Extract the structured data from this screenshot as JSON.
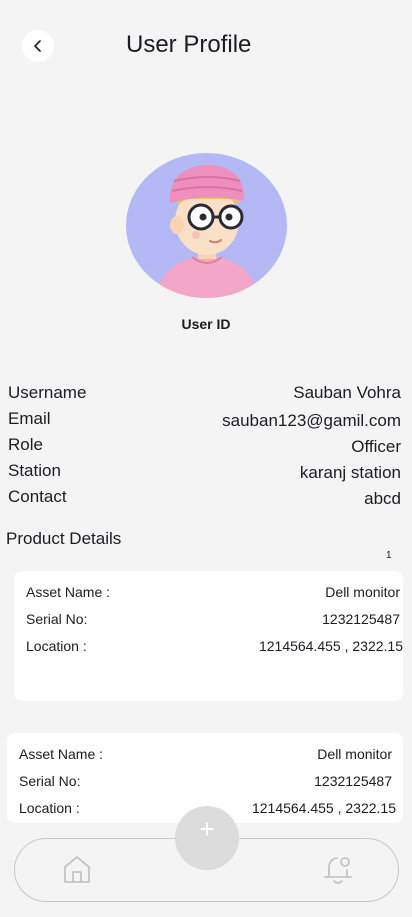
{
  "header": {
    "title": "User Profile"
  },
  "profile": {
    "user_id_label": "User ID"
  },
  "info": [
    {
      "label": "Username",
      "value": "Sauban Vohra"
    },
    {
      "label": "Email",
      "value": "sauban123@gamil.com"
    },
    {
      "label": "Role",
      "value": "Officer"
    },
    {
      "label": "Station",
      "value": "karanj station"
    },
    {
      "label": "Contact",
      "value": "abcd"
    }
  ],
  "products": {
    "title": "Product Details",
    "page_count": "1",
    "items": [
      {
        "asset_label": "Asset Name :",
        "asset_value": "Dell monitor",
        "serial_label": "Serial No:",
        "serial_value": "1232125487",
        "location_label": "Location :",
        "location_value": "1214564.455 , 2322.15"
      },
      {
        "asset_label": "Asset Name :",
        "asset_value": "Dell monitor",
        "serial_label": "Serial No:",
        "serial_value": "1232125487",
        "location_label": "Location :",
        "location_value": "1214564.455 , 2322.15"
      }
    ]
  },
  "nav": {
    "fab_symbol": "+",
    "icons": [
      "home-icon",
      "bell-icon",
      "plus-icon",
      "back-arrow-icon"
    ]
  }
}
